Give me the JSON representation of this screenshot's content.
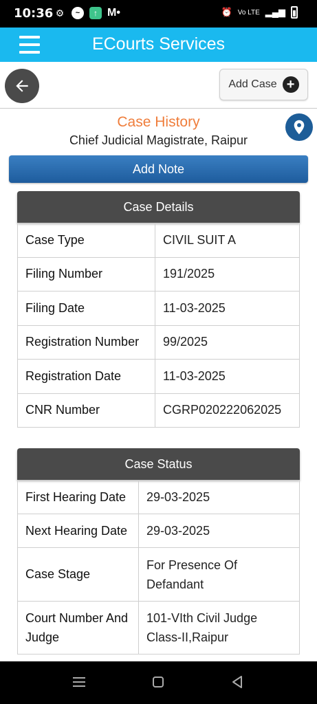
{
  "status_bar": {
    "time": "10:36",
    "mail_label": "M•",
    "network_label": "Vo LTE"
  },
  "app_bar": {
    "title": "ECourts Services"
  },
  "toolbar": {
    "add_case_label": "Add Case"
  },
  "header": {
    "title": "Case History",
    "court": "Chief Judicial Magistrate, Raipur"
  },
  "add_note_label": "Add Note",
  "case_details": {
    "title": "Case Details",
    "rows": [
      {
        "label": "Case Type",
        "value": "CIVIL SUIT A"
      },
      {
        "label": "Filing Number",
        "value": "191/2025"
      },
      {
        "label": "Filing Date",
        "value": "11-03-2025"
      },
      {
        "label": "Registration Number",
        "value": "99/2025"
      },
      {
        "label": "Registration Date",
        "value": "11-03-2025"
      },
      {
        "label": "CNR Number",
        "value": "CGRP020222062025"
      }
    ]
  },
  "case_status": {
    "title": "Case Status",
    "rows": [
      {
        "label": "First Hearing Date",
        "value": "29-03-2025"
      },
      {
        "label": "Next Hearing Date",
        "value": "29-03-2025"
      },
      {
        "label": "Case Stage",
        "value": "For Presence Of Defandant"
      },
      {
        "label": "Court Number And Judge",
        "value": "101-VIth Civil Judge Class-II,Raipur"
      }
    ]
  },
  "icons": {
    "menu": "hamburger-menu-icon",
    "back": "arrow-left-icon",
    "add": "plus-circle-icon",
    "location": "map-pin-icon"
  },
  "colors": {
    "app_bar": "#1ab9ef",
    "title_orange": "#ef7d3b",
    "button_blue": "#2a6cb0",
    "section_header": "#4a4a4a"
  }
}
